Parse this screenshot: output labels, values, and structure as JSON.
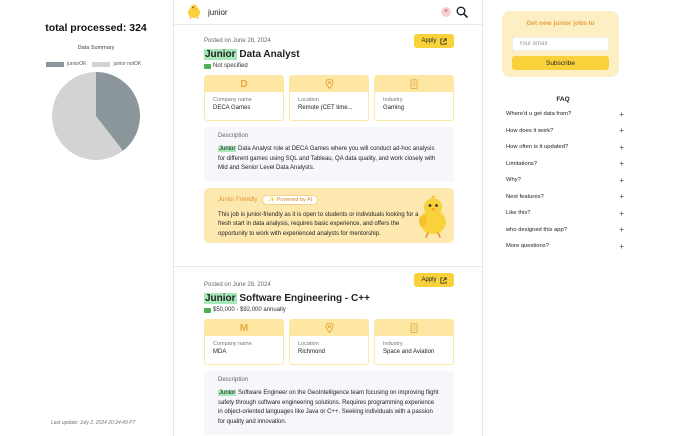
{
  "left": {
    "total_label": "total processed: 324",
    "summary_title": "Data Summary",
    "legend": [
      {
        "label": "juniorOK",
        "color": "#8a9699"
      },
      {
        "label": "junior notOK",
        "color": "#d3d3d3"
      }
    ],
    "pie": {
      "juniorOK": 0.395,
      "notOK": 0.605
    },
    "last_update": "Last update: July 2, 2024 20:24:49 PT"
  },
  "search": {
    "value": "junior",
    "clear_icon": "×"
  },
  "jobs": [
    {
      "posted": "Posted on June 28, 2024",
      "apply_label": "Apply",
      "title_hl": "Junior",
      "title_rest": " Data Analyst",
      "salary": "Not specified",
      "company_initial": "D",
      "company_label": "Company name",
      "company": "DECA Games",
      "location_label": "Location",
      "location": "Remote (CET time...",
      "industry_label": "Industry",
      "industry": "Gaming",
      "desc_label": "Description",
      "desc_hl": "Junior",
      "desc_rest": " Data Analyst role at DECA Games where you will conduct ad-hoc analysis for different games using SQL and Tableau, QA data quality, and work closely with Mid and Senior Level Data Analysts.",
      "jf_label": "Junior Friendly",
      "ai_badge": "✨ Powered by AI",
      "jf_text": "This job is junior-friendly as it is open to students or individuals looking for a fresh start in data analysis, requires basic experience, and offers the opportunity to work with experienced analysts for mentorship."
    },
    {
      "posted": "Posted on June 28, 2024",
      "apply_label": "Apply",
      "title_hl": "Junior",
      "title_rest": " Software Engineering - C++",
      "salary": "$50,000 - $92,000 annually",
      "company_initial": "M",
      "company_label": "Company name",
      "company": "MDA",
      "location_label": "Location",
      "location": "Richmond",
      "industry_label": "Industry",
      "industry": "Space and Aviation",
      "desc_label": "Description",
      "desc_hl": "Junior",
      "desc_rest": " Software Engineer on the GeoIntelligence team focusing on improving flight safety through software engineering solutions. Requires programming experience in object-oriented languages like Java or C++. Seeking individuals with a passion for quality and innovation."
    }
  ],
  "newsletter": {
    "title": "Get new junior jobs to",
    "email_placeholder": "Your email",
    "subscribe_label": "Subscribe"
  },
  "faq": {
    "title": "FAQ",
    "plus": "+",
    "items": [
      "Where'd u get data from?",
      "How does it work?",
      "How often is it updated?",
      "Limitations?",
      "Why?",
      "Next features?",
      "Like this?",
      "who designed this app?",
      "More questions?"
    ]
  },
  "colors": {
    "accent": "#f9d23b",
    "highlight": "#a6e8b8",
    "card_header": "#fde7a2",
    "junior_box": "#fde9b0"
  }
}
